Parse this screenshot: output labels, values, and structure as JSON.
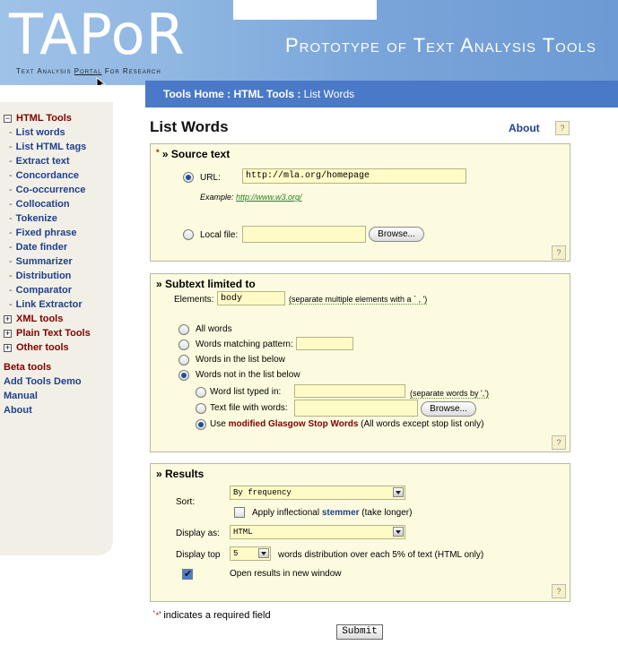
{
  "header": {
    "logo": "TAPoR",
    "logo_tag_a": "Text Analysis ",
    "logo_tag_b": "Portal",
    "logo_tag_c": " For Research",
    "tagline": "Prototype of Text Analysis Tools"
  },
  "breadcrumb": {
    "home": "Tools Home",
    "sep1": " : ",
    "html": "HTML Tools",
    "sep2": " : ",
    "current": "List Words"
  },
  "sidebar": {
    "html_tools": "HTML Tools",
    "html_items": [
      "List words",
      "List HTML tags",
      "Extract text",
      "Concordance",
      "Co-occurrence",
      "Collocation",
      "Tokenize",
      "Fixed phrase",
      "Date finder",
      "Summarizer",
      "Distribution",
      "Comparator",
      "Link Extractor"
    ],
    "xml_tools": "XML tools",
    "plain_text_tools": "Plain Text Tools",
    "other_tools": "Other tools",
    "beta_tools": "Beta tools",
    "add_tools_demo": "Add Tools Demo",
    "manual": "Manual",
    "about": "About"
  },
  "main": {
    "title": "List Words",
    "about": "About",
    "help": "?"
  },
  "source": {
    "star": "*",
    "title": "» Source text",
    "url_label": "URL:",
    "url_value": "http://mla.org/homepage",
    "example_label": "Example: ",
    "example_link": "http://www.w3.org/",
    "local_label": "Local file:",
    "browse": "Browse..."
  },
  "subtext": {
    "title": "» Subtext limited to",
    "elements_label": "Elements:",
    "elements_value": "body",
    "elements_note": "(separate multiple elements with a ` , ')",
    "opt_all": "All words",
    "opt_pattern": "Words matching pattern:",
    "opt_inlist": "Words in the list below",
    "opt_notinlist": "Words not in the list below",
    "sub_typed": "Word list typed in:",
    "sub_typed_note": "(separate words by ',')",
    "sub_file": "Text file with words:",
    "browse": "Browse...",
    "sub_use_a": "Use ",
    "sub_use_b": "modified Glasgow Stop Words",
    "sub_use_c": " (All words except stop list only)"
  },
  "results": {
    "title": "» Results",
    "sort_label": "Sort:",
    "sort_value": "By frequency",
    "stemmer_a": "Apply inflectional ",
    "stemmer_b": "stemmer",
    "stemmer_c": " (take longer)",
    "display_label": "Display as:",
    "display_value": "HTML",
    "top_label": "Display top",
    "top_value": "5",
    "top_note": "words distribution over each 5% of text (HTML only)",
    "newwin": "Open results in new window"
  },
  "footer": {
    "req_a": "`",
    "req_star": "*",
    "req_b": "' indicates a required field",
    "submit": "Submit"
  }
}
